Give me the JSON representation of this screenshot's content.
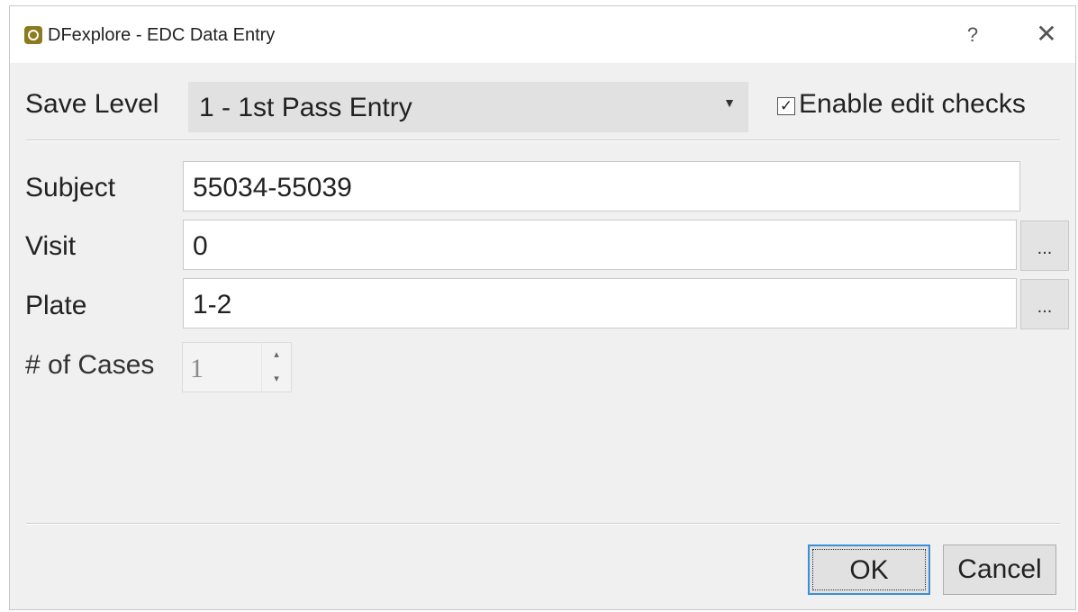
{
  "window": {
    "title": "DFexplore - EDC Data Entry",
    "help_glyph": "?",
    "close_glyph": "✕",
    "icon": "dfexplore-app-icon"
  },
  "save_level": {
    "label": "Save Level",
    "selected": "1 - 1st Pass Entry",
    "dropdown_icon": "chevron-down-icon"
  },
  "edit_checks": {
    "label": "Enable edit checks",
    "checked": true,
    "check_glyph": "✓"
  },
  "form": {
    "subject": {
      "label": "Subject",
      "value": "55034-55039"
    },
    "visit": {
      "label": "Visit",
      "value": "0",
      "browse": "..."
    },
    "plate": {
      "label": "Plate",
      "value": "1-2",
      "browse": "..."
    },
    "cases": {
      "label": "# of Cases",
      "value": "1",
      "up": "▴",
      "down": "▾"
    }
  },
  "buttons": {
    "ok": "OK",
    "cancel": "Cancel"
  },
  "colors": {
    "default_button_border": "#3b8fd6",
    "dialog_background": "#f0f0f0"
  }
}
